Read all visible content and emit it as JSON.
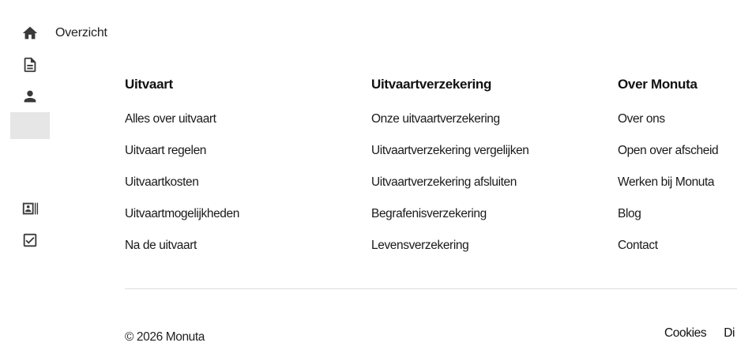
{
  "sidebar": {
    "overview_label": "Overzicht",
    "icons": [
      "home-icon",
      "document-icon",
      "person-icon",
      "contact-card-icon",
      "checkbox-icon"
    ]
  },
  "footer": {
    "columns": [
      {
        "heading": "Uitvaart",
        "links": [
          "Alles over uitvaart",
          "Uitvaart regelen",
          "Uitvaartkosten",
          "Uitvaartmogelijkheden",
          "Na de uitvaart"
        ]
      },
      {
        "heading": "Uitvaartverzekering",
        "links": [
          "Onze uitvaartverzekering",
          "Uitvaartverzekering vergelijken",
          "Uitvaartverzekering afsluiten",
          "Begrafenisverzekering",
          "Levensverzekering"
        ]
      },
      {
        "heading": "Over Monuta",
        "links": [
          "Over ons",
          "Open over afscheid",
          "Werken bij Monuta",
          "Blog",
          "Contact"
        ]
      }
    ],
    "copyright": "© 2026 Monuta",
    "bottom_links": [
      "Cookies",
      "Di"
    ]
  }
}
